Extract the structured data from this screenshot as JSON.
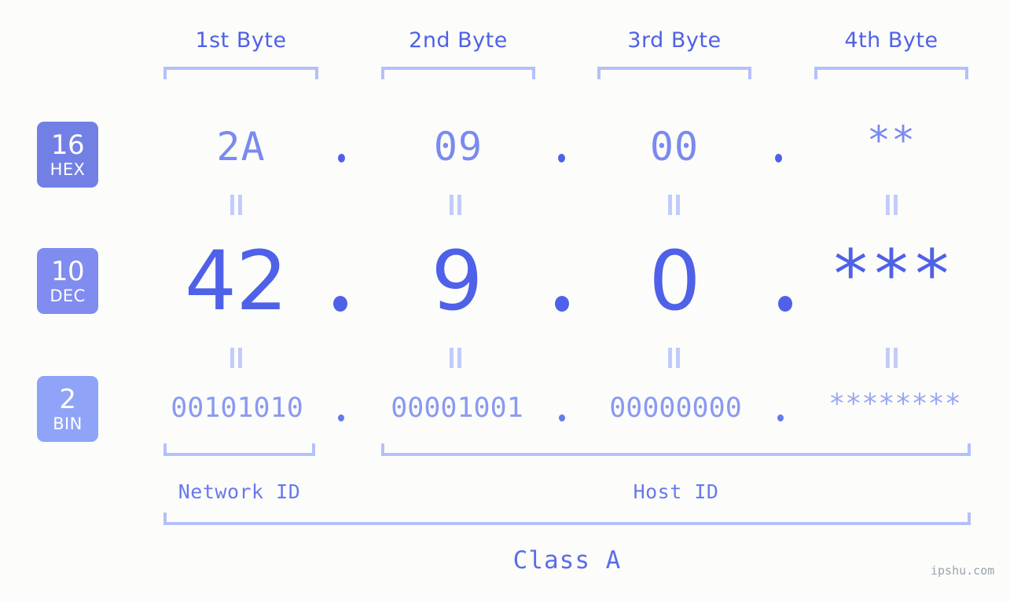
{
  "page": {
    "background_color": "#fcfdfa",
    "accent_color": "#4f61e8",
    "accent_light_color": "#b4c0fb",
    "badge_color": "#7280e5",
    "badge_color_light": "#8fa4f8"
  },
  "byte_headers": [
    {
      "label": "1st Byte"
    },
    {
      "label": "2nd Byte"
    },
    {
      "label": "3rd Byte"
    },
    {
      "label": "4th Byte"
    }
  ],
  "rows": [
    {
      "badge": {
        "base": "16",
        "abbr": "HEX",
        "color": "#7280e5"
      },
      "values": [
        "2A",
        "09",
        "00",
        "**"
      ],
      "separator": "."
    },
    {
      "badge": {
        "base": "10",
        "abbr": "DEC",
        "color": "#808cf0"
      },
      "values": [
        "42",
        "9",
        "0",
        "***"
      ],
      "separator": "."
    },
    {
      "badge": {
        "base": "2",
        "abbr": "BIN",
        "color": "#8fa4f8"
      },
      "values": [
        "00101010",
        "00001001",
        "00000000",
        "********"
      ],
      "separator": "."
    }
  ],
  "equivalence_symbol": "=",
  "segments": [
    {
      "label": "Network ID"
    },
    {
      "label": "Host ID"
    }
  ],
  "class": {
    "label": "Class A"
  },
  "watermark": {
    "text": "ipshu.com"
  }
}
